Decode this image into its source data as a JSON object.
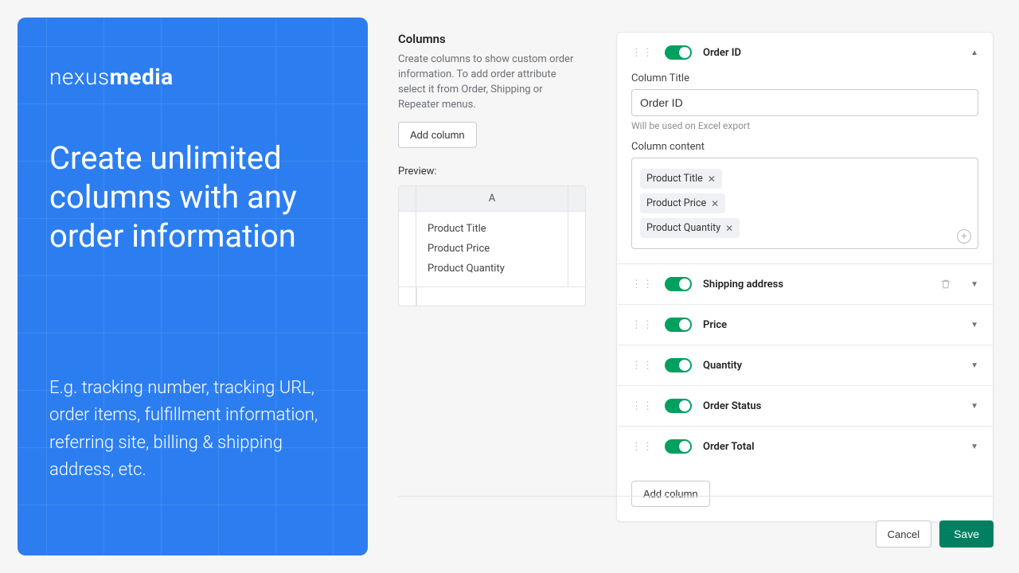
{
  "promo": {
    "brand_thin": "nexus",
    "brand_bold": "media",
    "headline": "Create unlimited columns with any order information",
    "subtext": "E.g. tracking number, tracking URL, order items, fulfillment information, referring site, billing & shipping address, etc."
  },
  "left": {
    "title": "Columns",
    "desc": "Create columns to show custom order information. To add order attribute select it from Order, Shipping or Repeater menus.",
    "add_button": "Add column",
    "preview_label": "Preview:"
  },
  "preview": {
    "header": "A",
    "rows": [
      "Product Title",
      "Product Price",
      "Product Quantity"
    ]
  },
  "expanded": {
    "name": "Order ID",
    "title_label": "Column Title",
    "title_value": "Order ID",
    "hint": "Will be used on Excel export",
    "content_label": "Column content"
  },
  "tags": [
    "Product Title",
    "Product Price",
    "Product Quantity"
  ],
  "columns": [
    "Shipping address",
    "Price",
    "Quantity",
    "Order Status",
    "Order Total"
  ],
  "footer": {
    "add": "Add column",
    "cancel": "Cancel",
    "save": "Save"
  }
}
